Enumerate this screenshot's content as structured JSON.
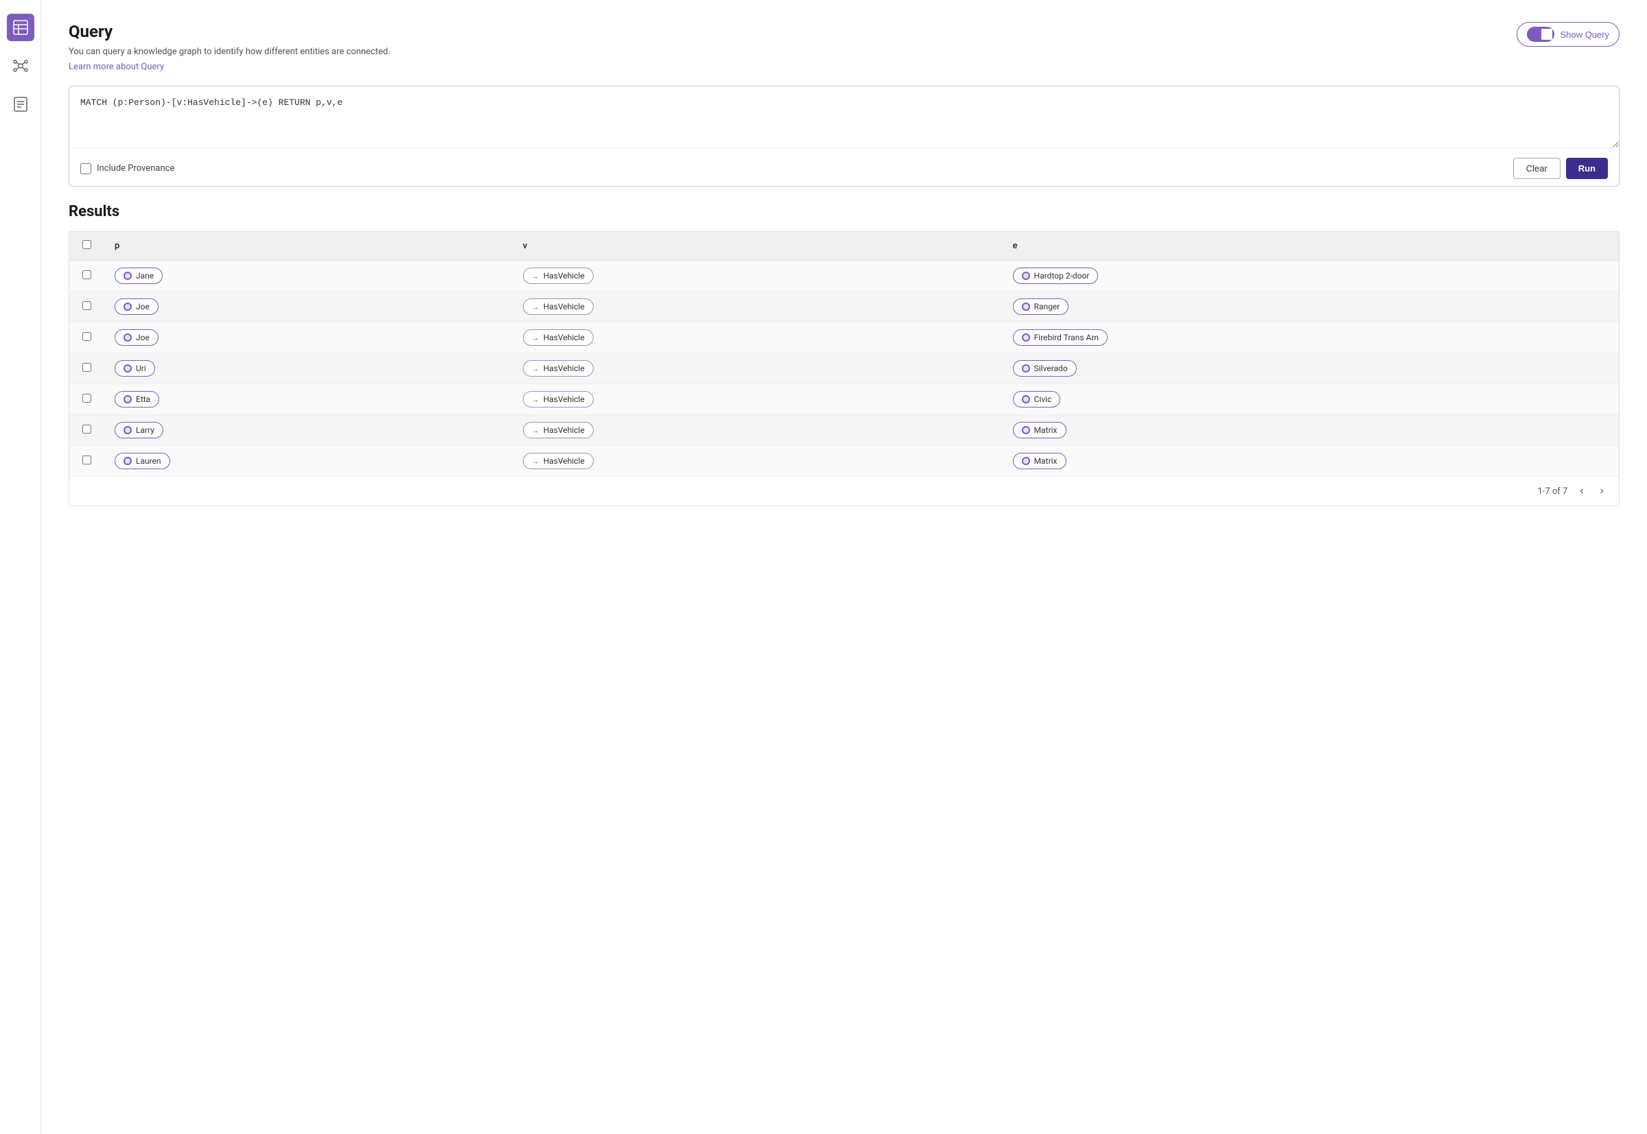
{
  "page": {
    "title": "Query",
    "subtitle": "You can query a knowledge graph to identify how different entities are connected.",
    "learn_more_label": "Learn more about Query",
    "show_query_label": "Show Query"
  },
  "query": {
    "text": "MATCH (p:Person)-[v:HasVehicle]->(e) RETURN p,v,e",
    "include_provenance_label": "Include Provenance",
    "clear_label": "Clear",
    "run_label": "Run"
  },
  "results": {
    "title": "Results",
    "pagination": "1-7 of 7",
    "columns": [
      {
        "key": "checkbox",
        "label": ""
      },
      {
        "key": "p",
        "label": "p"
      },
      {
        "key": "v",
        "label": "v"
      },
      {
        "key": "e",
        "label": "e"
      }
    ],
    "rows": [
      {
        "p": "Jane",
        "v": "HasVehicle",
        "e": "Hardtop 2-door"
      },
      {
        "p": "Joe",
        "v": "HasVehicle",
        "e": "Ranger"
      },
      {
        "p": "Joe",
        "v": "HasVehicle",
        "e": "Firebird Trans Am"
      },
      {
        "p": "Uri",
        "v": "HasVehicle",
        "e": "Silverado"
      },
      {
        "p": "Etta",
        "v": "HasVehicle",
        "e": "Civic"
      },
      {
        "p": "Larry",
        "v": "HasVehicle",
        "e": "Matrix"
      },
      {
        "p": "Lauren",
        "v": "HasVehicle",
        "e": "Matrix"
      }
    ]
  },
  "sidebar": {
    "icons": [
      {
        "name": "table-icon",
        "symbol": "⊞",
        "active": true
      },
      {
        "name": "graph-icon",
        "symbol": "✦",
        "active": false
      },
      {
        "name": "report-icon",
        "symbol": "⧉",
        "active": false
      }
    ]
  },
  "colors": {
    "accent": "#7c5cbf",
    "dark_button": "#3d2c8d"
  }
}
